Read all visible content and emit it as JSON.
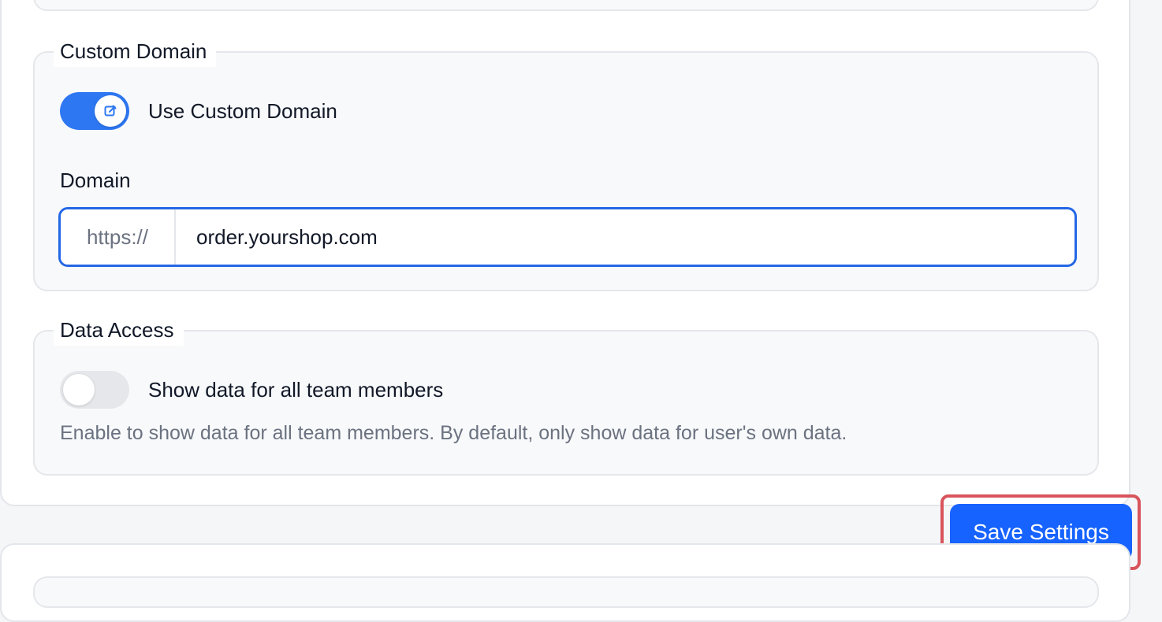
{
  "custom_domain": {
    "legend": "Custom Domain",
    "toggle": {
      "label": "Use Custom Domain",
      "state": "on",
      "icon": "edit-icon"
    },
    "domain_label": "Domain",
    "domain_prefix": "https://",
    "domain_value": "order.yourshop.com"
  },
  "data_access": {
    "legend": "Data Access",
    "toggle": {
      "label": "Show data for all team members",
      "state": "off"
    },
    "help_text": "Enable to show data for all team members. By default, only show data for user's own data."
  },
  "actions": {
    "save_label": "Save Settings"
  },
  "colors": {
    "accent": "#2e77f2",
    "button": "#1663ff",
    "highlight": "#d9545c"
  }
}
